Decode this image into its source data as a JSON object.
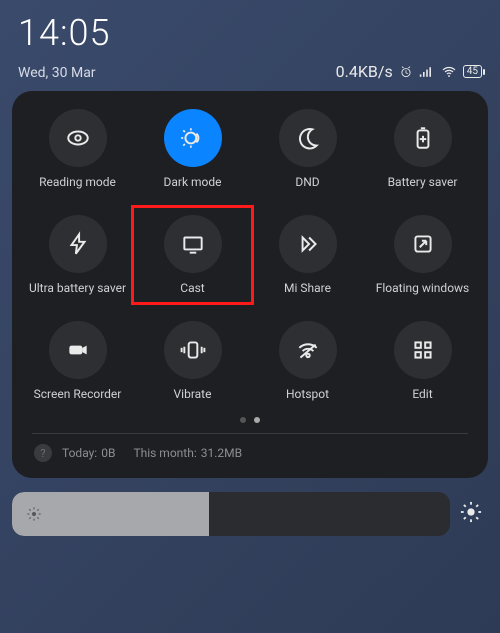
{
  "status": {
    "time": "14:05",
    "date": "Wed, 30 Mar",
    "net_speed": "0.4KB/s",
    "battery": "45"
  },
  "tiles": [
    {
      "icon": "eye-icon",
      "label": "Reading mode",
      "active": false
    },
    {
      "icon": "moon-sun-icon",
      "label": "Dark mode",
      "active": true
    },
    {
      "icon": "moon-icon",
      "label": "DND",
      "active": false
    },
    {
      "icon": "battery-plus-icon",
      "label": "Battery saver",
      "active": false
    },
    {
      "icon": "bolt-icon",
      "label": "Ultra battery saver",
      "active": false
    },
    {
      "icon": "cast-icon",
      "label": "Cast",
      "active": false,
      "highlight": true
    },
    {
      "icon": "mishare-icon",
      "label": "Mi Share",
      "active": false
    },
    {
      "icon": "floatwin-icon",
      "label": "Floating windows",
      "active": false
    },
    {
      "icon": "videocam-icon",
      "label": "Screen Recorder",
      "active": false
    },
    {
      "icon": "vibrate-icon",
      "label": "Vibrate",
      "active": false
    },
    {
      "icon": "hotspot-icon",
      "label": "Hotspot",
      "active": false
    },
    {
      "icon": "grid-icon",
      "label": "Edit",
      "active": false
    }
  ],
  "usage": {
    "today_label": "Today:",
    "today_value": "0B",
    "month_label": "This month:",
    "month_value": "31.2MB"
  }
}
